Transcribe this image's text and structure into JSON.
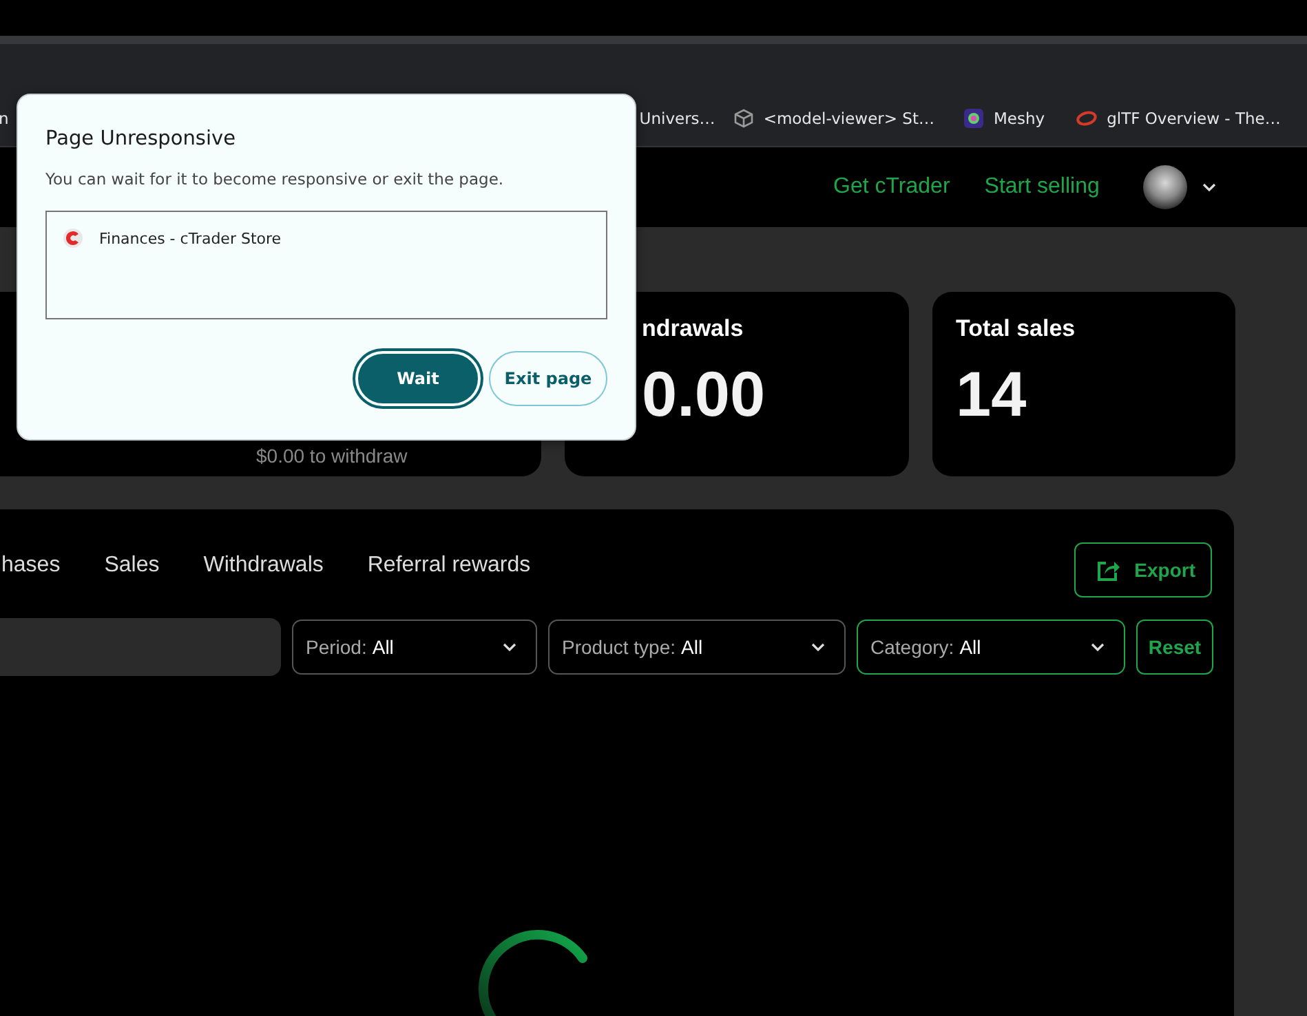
{
  "bookmarks": [
    {
      "label": "n"
    },
    {
      "label": "Univers…"
    },
    {
      "label": "<model-viewer> St…"
    },
    {
      "label": "Meshy"
    },
    {
      "label": "glTF Overview - The…"
    }
  ],
  "header": {
    "links": [
      "Get cTrader",
      "Start selling"
    ]
  },
  "cards": [
    {
      "note": "$0.00 to withdraw"
    },
    {
      "title": "ndrawals",
      "value": "0.00"
    },
    {
      "title": "Total sales",
      "value": "14"
    }
  ],
  "panel": {
    "tabs": [
      {
        "label": "hases",
        "selected": false
      },
      {
        "label": "Sales",
        "selected": false
      },
      {
        "label": "Withdrawals",
        "selected": false
      },
      {
        "label": "Referral rewards",
        "selected": false
      }
    ],
    "export_button": "Export",
    "filters": [
      {
        "label": "Period:",
        "value": "All",
        "highlighted": false
      },
      {
        "label": "Product type:",
        "value": "All",
        "highlighted": false
      },
      {
        "label": "Category:",
        "value": "All",
        "highlighted": true
      }
    ],
    "reset_button": "Reset"
  },
  "dialog": {
    "title": "Page Unresponsive",
    "message": "You can wait for it to become responsive or exit the page.",
    "pages": [
      "Finances - cTrader Store"
    ],
    "buttons": [
      {
        "label": "Wait",
        "primary": true
      },
      {
        "label": "Exit page",
        "primary": false
      }
    ]
  }
}
